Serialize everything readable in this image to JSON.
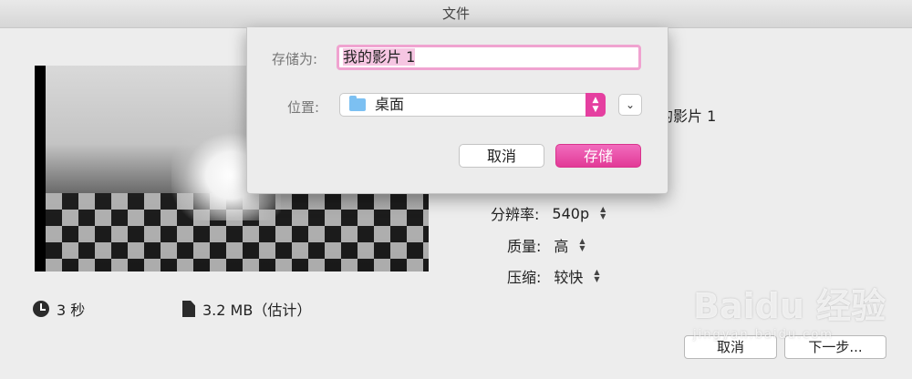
{
  "window": {
    "title": "文件"
  },
  "info": {
    "duration": "3 秒",
    "size": "3.2 MB（估计）"
  },
  "export_settings": {
    "name_peek": "的影片 1",
    "resolution_label": "分辨率:",
    "resolution_value": "540p",
    "quality_label": "质量:",
    "quality_value": "高",
    "compress_label": "压缩:",
    "compress_value": "较快"
  },
  "footer": {
    "cancel_label": "取消",
    "next_label": "下一步..."
  },
  "save_sheet": {
    "save_as_label": "存储为:",
    "filename": "我的影片 1",
    "location_label": "位置:",
    "location_value": "桌面",
    "cancel_label": "取消",
    "save_label": "存储"
  },
  "watermark": {
    "brand": "Baidu 经验",
    "url": "jingyan.baidu.com"
  },
  "colors": {
    "accent": "#e53fa0",
    "focus_ring": "#f0a3d0"
  },
  "icons": [
    "clock-icon",
    "document-icon",
    "folder-icon",
    "popup-arrows-icon",
    "chevron-down-icon",
    "stepper-icon"
  ]
}
